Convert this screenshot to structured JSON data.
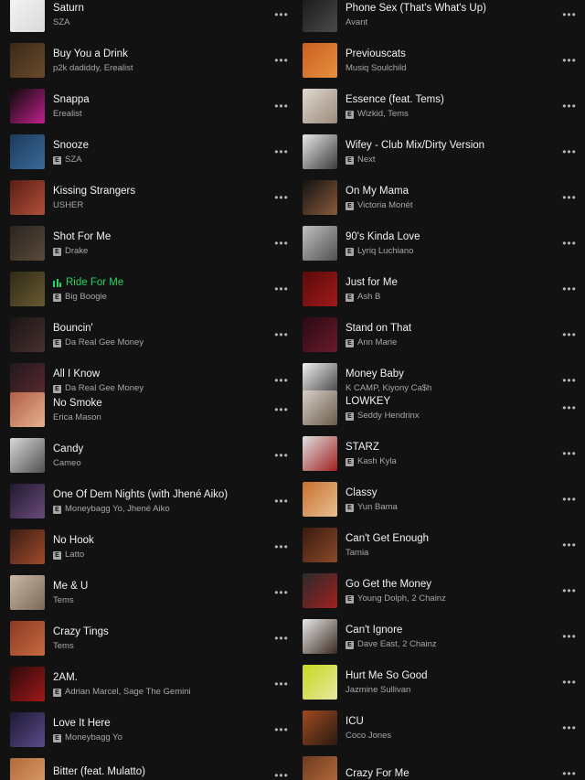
{
  "left_tracks": [
    {
      "title": "Saturn",
      "artist": "SZA",
      "explicit": false,
      "playing": false,
      "cover": [
        "#f4f4f4",
        "#d9d9d9"
      ]
    },
    {
      "title": "Buy You a Drink",
      "artist": "p2k dadiddy, Erealist",
      "explicit": false,
      "playing": false,
      "cover": [
        "#3a2a1a",
        "#6b4a2a"
      ]
    },
    {
      "title": "Snappa",
      "artist": "Erealist",
      "explicit": false,
      "playing": false,
      "cover": [
        "#0a0a0a",
        "#c0208a"
      ]
    },
    {
      "title": "Snooze",
      "artist": "SZA",
      "explicit": true,
      "playing": false,
      "cover": [
        "#1c3a5a",
        "#3a6a9a"
      ]
    },
    {
      "title": "Kissing Strangers",
      "artist": "USHER",
      "explicit": false,
      "playing": false,
      "cover": [
        "#5a1e14",
        "#b0503a"
      ]
    },
    {
      "title": "Shot For Me",
      "artist": "Drake",
      "explicit": true,
      "playing": false,
      "cover": [
        "#2a2420",
        "#5a4a3a"
      ]
    },
    {
      "title": "Ride For Me",
      "artist": "Big Boogie",
      "explicit": true,
      "playing": true,
      "cover": [
        "#2e2a18",
        "#6a5a30"
      ]
    },
    {
      "title": "Bouncin'",
      "artist": "Da Real Gee Money",
      "explicit": true,
      "playing": false,
      "cover": [
        "#1a1414",
        "#4a3030"
      ]
    },
    {
      "title": "All I Know",
      "artist": "Da Real Gee Money",
      "explicit": true,
      "playing": false,
      "cover": [
        "#20181c",
        "#5a2a30"
      ]
    },
    {
      "title": "No Smoke",
      "artist": "Erica Mason",
      "explicit": false,
      "playing": false,
      "cover": [
        "#b06048",
        "#e8b090"
      ]
    },
    {
      "title": "Candy",
      "artist": "Cameo",
      "explicit": false,
      "playing": false,
      "cover": [
        "#d8d8d8",
        "#505050"
      ]
    },
    {
      "title": "One Of Dem Nights (with Jhené Aiko)",
      "artist": "Moneybagg Yo, Jhené Aiko",
      "explicit": true,
      "playing": false,
      "cover": [
        "#201a30",
        "#6a4a7a"
      ]
    },
    {
      "title": "No Hook",
      "artist": "Latto",
      "explicit": true,
      "playing": false,
      "cover": [
        "#3a1e14",
        "#a04a2a"
      ]
    },
    {
      "title": "Me & U",
      "artist": "Tems",
      "explicit": false,
      "playing": false,
      "cover": [
        "#c8b8a8",
        "#7a6a5a"
      ]
    },
    {
      "title": "Crazy Tings",
      "artist": "Tems",
      "explicit": false,
      "playing": false,
      "cover": [
        "#8a3a24",
        "#c86a40"
      ]
    },
    {
      "title": "2AM.",
      "artist": "Adrian Marcel, Sage The Gemini",
      "explicit": true,
      "playing": false,
      "cover": [
        "#2a0a0a",
        "#a01818"
      ]
    },
    {
      "title": "Love It Here",
      "artist": "Moneybagg Yo",
      "explicit": true,
      "playing": false,
      "cover": [
        "#1e1a34",
        "#5a4a8a"
      ]
    },
    {
      "title": "Bitter (feat. Mulatto)",
      "artist": "",
      "explicit": true,
      "playing": false,
      "cover": [
        "#b06a3a",
        "#e0a070"
      ]
    }
  ],
  "right_tracks": [
    {
      "title": "Phone Sex (That's What's Up)",
      "artist": "Avant",
      "explicit": false,
      "playing": false,
      "cover": [
        "#1a1a1a",
        "#4a4a4a"
      ]
    },
    {
      "title": "Previouscats",
      "artist": "Musiq Soulchild",
      "explicit": false,
      "playing": false,
      "cover": [
        "#c86020",
        "#e89040"
      ]
    },
    {
      "title": "Essence (feat. Tems)",
      "artist": "Wizkid, Tems",
      "explicit": true,
      "playing": false,
      "cover": [
        "#e0d8d0",
        "#9a8a7a"
      ]
    },
    {
      "title": "Wifey - Club Mix/Dirty Version",
      "artist": "Next",
      "explicit": true,
      "playing": false,
      "cover": [
        "#e8e8e8",
        "#3a3a3a"
      ]
    },
    {
      "title": "On My Mama",
      "artist": "Victoria Monét",
      "explicit": true,
      "playing": false,
      "cover": [
        "#121212",
        "#8a5a3a"
      ]
    },
    {
      "title": "90's Kinda Love",
      "artist": "Lyriq Luchiano",
      "explicit": true,
      "playing": false,
      "cover": [
        "#c0c0c0",
        "#505050"
      ]
    },
    {
      "title": "Just for Me",
      "artist": "Ash B",
      "explicit": true,
      "playing": false,
      "cover": [
        "#5a0a0a",
        "#a01a1a"
      ]
    },
    {
      "title": "Stand on That",
      "artist": "Ann Marie",
      "explicit": true,
      "playing": false,
      "cover": [
        "#2a0a14",
        "#6a1a2a"
      ]
    },
    {
      "title": "Money Baby",
      "artist": "K CAMP, Kiyony Ca$h",
      "explicit": false,
      "playing": false,
      "cover": [
        "#f0f0f0",
        "#3a3a3a"
      ]
    },
    {
      "title": "LOWKEY",
      "artist": "Seddy Hendrinx",
      "explicit": true,
      "playing": false,
      "cover": [
        "#d8d0c8",
        "#6a5a4a"
      ]
    },
    {
      "title": "STARZ",
      "artist": "Kash Kyla",
      "explicit": true,
      "playing": false,
      "cover": [
        "#e0e0e0",
        "#a02020"
      ]
    },
    {
      "title": "Classy",
      "artist": "Yun Bama",
      "explicit": true,
      "playing": false,
      "cover": [
        "#c87030",
        "#e8c090"
      ]
    },
    {
      "title": "Can't Get Enough",
      "artist": "Tamia",
      "explicit": false,
      "playing": false,
      "cover": [
        "#3a1a10",
        "#8a4a2a"
      ]
    },
    {
      "title": "Go Get the Money",
      "artist": "Young Dolph, 2 Chainz",
      "explicit": true,
      "playing": false,
      "cover": [
        "#2a2a2a",
        "#a02020"
      ]
    },
    {
      "title": "Can't Ignore",
      "artist": "Dave East, 2 Chainz",
      "explicit": true,
      "playing": false,
      "cover": [
        "#e8e8e8",
        "#3a2a20"
      ]
    },
    {
      "title": "Hurt Me So Good",
      "artist": "Jazmine Sullivan",
      "explicit": false,
      "playing": false,
      "cover": [
        "#c8d820",
        "#e8e8a0"
      ]
    },
    {
      "title": "ICU",
      "artist": "Coco Jones",
      "explicit": false,
      "playing": false,
      "cover": [
        "#a04a20",
        "#2a1a10"
      ]
    },
    {
      "title": "Crazy For Me",
      "artist": "",
      "explicit": false,
      "playing": false,
      "cover": [
        "#6a3a20",
        "#c07040"
      ]
    }
  ],
  "more_label": "•••",
  "explicit_label": "E",
  "colors": {
    "background": "#121212",
    "accent": "#1ed760",
    "text": "#f2f2f2",
    "subtext": "#a7a7a7"
  }
}
